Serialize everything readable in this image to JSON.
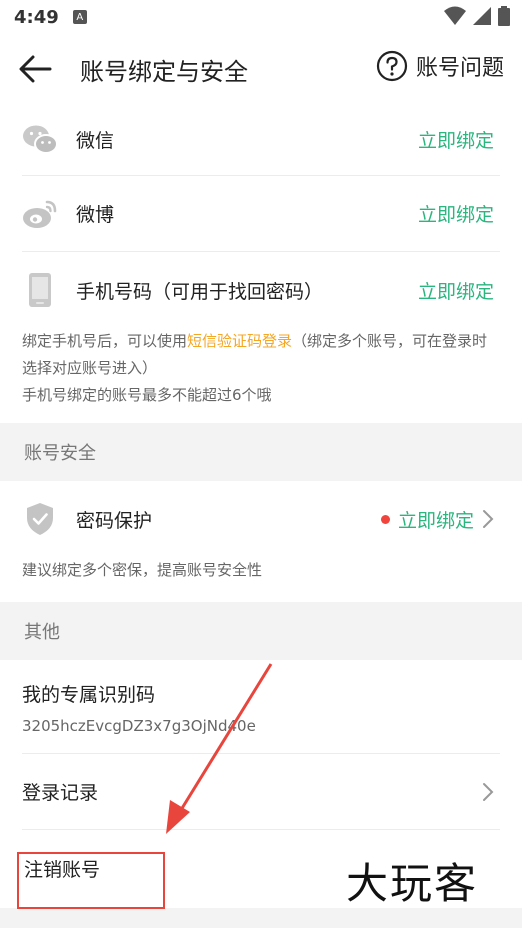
{
  "status": {
    "time": "4:49",
    "badge": "A"
  },
  "header": {
    "title": "账号绑定与安全",
    "help_label": "账号问题"
  },
  "bindings": [
    {
      "label": "微信",
      "action": "立即绑定",
      "icon": "wechat-icon"
    },
    {
      "label": "微博",
      "action": "立即绑定",
      "icon": "weibo-icon"
    },
    {
      "label": "手机号码（可用于找回密码）",
      "action": "立即绑定",
      "icon": "phone-icon"
    }
  ],
  "bind_hint": {
    "part1": "绑定手机号后，可以使用",
    "highlight": "短信验证码登录",
    "part2": "（绑定多个账号，可在登录时选择对应账号进入）",
    "line2": "手机号绑定的账号最多不能超过6个哦"
  },
  "security": {
    "section_title": "账号安全",
    "password_label": "密码保护",
    "password_action": "立即绑定",
    "hint": "建议绑定多个密保，提高账号安全性"
  },
  "other": {
    "section_title": "其他",
    "code_title": "我的专属识别码",
    "code_value": "3205hczEvcgDZ3x7g3OjNd40e",
    "login_record": "登录记录",
    "cancel_account": "注销账号"
  },
  "watermark": "大玩客",
  "colors": {
    "accent_green": "#2bb57f",
    "highlight_orange": "#f5a623",
    "annotation_red": "#e8453c"
  }
}
